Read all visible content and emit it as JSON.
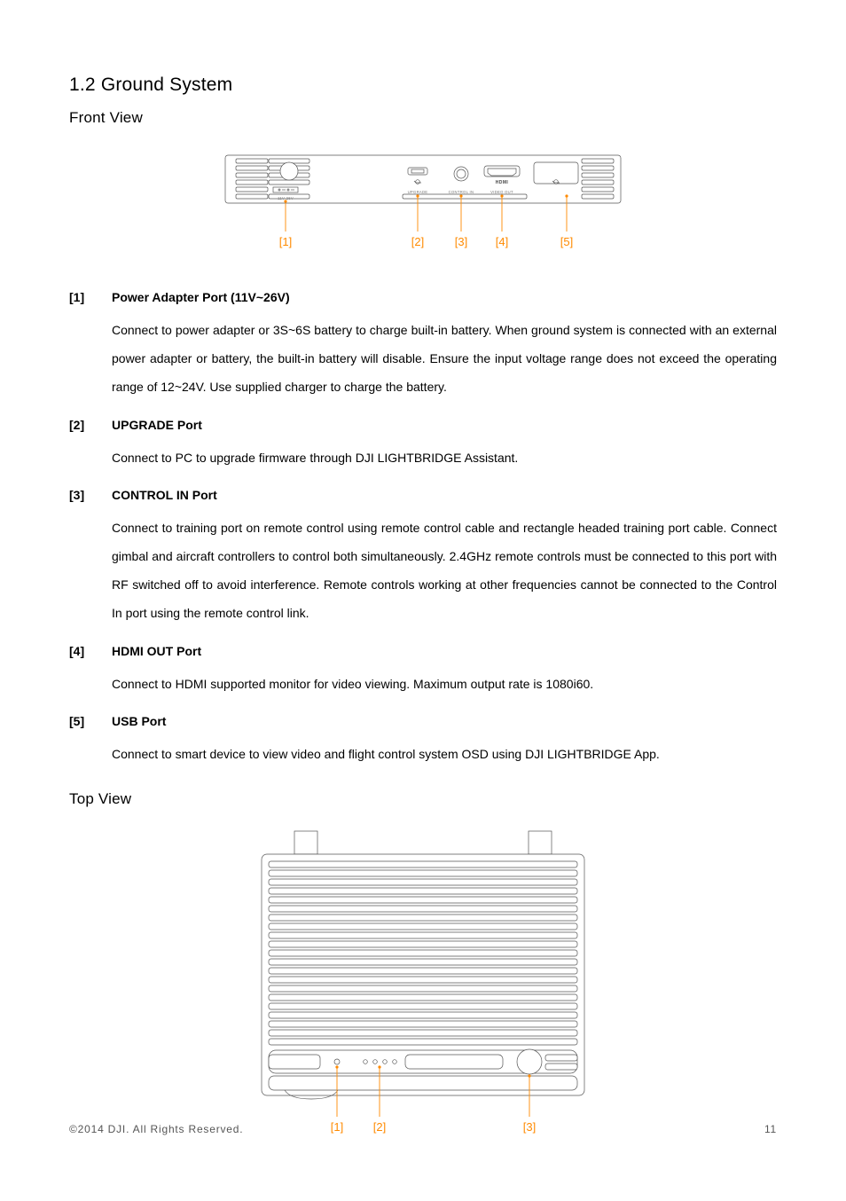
{
  "section": {
    "title": "1.2 Ground System",
    "front_view_heading": "Front View",
    "top_view_heading": "Top View"
  },
  "front_diagram": {
    "labels": {
      "power": "11V-26V",
      "upgrade": "UPGRADE",
      "control_in": "CONTROL IN",
      "hdmi": "HDMI",
      "video_out": "VIDEO OUT"
    },
    "callouts": [
      "[1]",
      "[2]",
      "[3]",
      "[4]",
      "[5]"
    ]
  },
  "front_items": [
    {
      "num": "[1]",
      "title": "Power Adapter Port (11V~26V)",
      "desc": "Connect to power adapter or 3S~6S battery to charge built-in battery. When ground system is connected with an external power adapter or battery, the built-in battery will disable. Ensure the input voltage range does not exceed the operating range of 12~24V. Use supplied charger to charge the battery."
    },
    {
      "num": "[2]",
      "title": "UPGRADE Port",
      "desc": "Connect to PC to upgrade firmware through DJI LIGHTBRIDGE Assistant."
    },
    {
      "num": "[3]",
      "title": "CONTROL IN Port",
      "desc": "Connect to training port on remote control using remote control cable and rectangle headed training port cable. Connect gimbal and aircraft controllers to control both simultaneously. 2.4GHz remote controls must be connected to this port with RF switched off to avoid interference. Remote controls working at other frequencies cannot be connected to the Control In port using the remote control link."
    },
    {
      "num": "[4]",
      "title": "HDMI OUT Port",
      "desc": "Connect to HDMI supported monitor for video viewing. Maximum output rate is 1080i60."
    },
    {
      "num": "[5]",
      "title": "USB Port",
      "desc": "Connect to smart device to view video and flight control system OSD using DJI LIGHTBRIDGE App."
    }
  ],
  "top_diagram": {
    "callouts": [
      "[1]",
      "[2]",
      "[3]"
    ]
  },
  "footer": {
    "copyright": "©2014 DJI. All Rights Reserved.",
    "page": "11"
  }
}
